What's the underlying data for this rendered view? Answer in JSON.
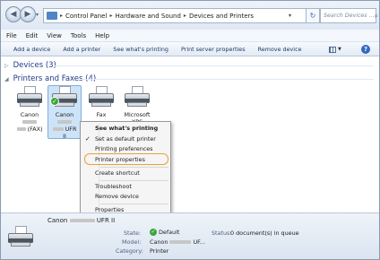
{
  "nav": {
    "back_glyph": "◀",
    "forward_glyph": "▶",
    "address": [
      "Control Panel",
      "Hardware and Sound",
      "Devices and Printers"
    ],
    "search_placeholder": "Search Devices ..."
  },
  "menu": [
    "File",
    "Edit",
    "View",
    "Tools",
    "Help"
  ],
  "commands": [
    "Add a device",
    "Add a printer",
    "See what's printing",
    "Print server properties",
    "Remove device"
  ],
  "groups": {
    "devices": "Devices (3)",
    "printers": "Printers and Faxes (4)"
  },
  "printers": [
    {
      "line1": "Canon",
      "line3": "(FAX)"
    },
    {
      "line1": "Canon",
      "line3": "UFR",
      "line4": "II"
    },
    {
      "line1": "Fax"
    },
    {
      "line1": "Microsoft",
      "line2": "XPS"
    }
  ],
  "context_menu": {
    "items": [
      "See what's printing",
      "Set as default printer",
      "Printing preferences",
      "Printer properties",
      "Create shortcut",
      "Troubleshoot",
      "Remove device",
      "Properties"
    ]
  },
  "details": {
    "name_prefix": "Canon",
    "name_suffix": "UFR II",
    "state_key": "State:",
    "state_value": "Default",
    "status_key": "Status:",
    "status_value": "0 document(s) in queue",
    "model_key": "Model:",
    "model_prefix": "Canon",
    "model_suffix": "UF...",
    "category_key": "Category:",
    "category_value": "Printer"
  },
  "colors": {
    "selection": "#cde3f8",
    "highlight_ring": "#e9a23b",
    "link_blue": "#1e3a8a"
  }
}
